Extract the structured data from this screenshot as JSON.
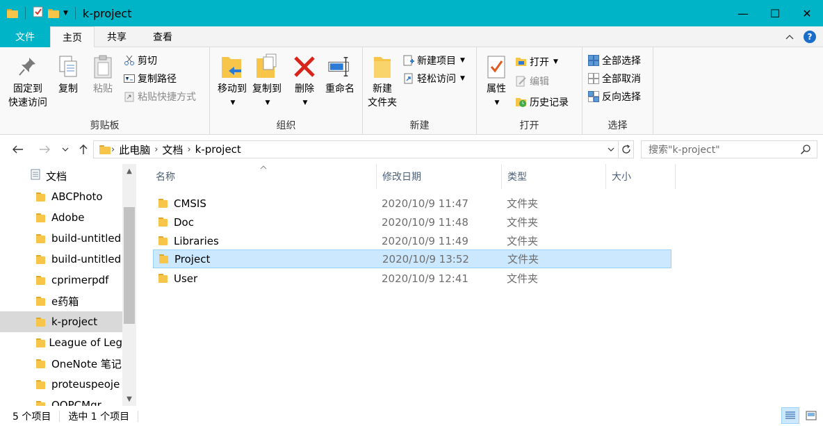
{
  "window": {
    "title": "k-project",
    "minimize": "—",
    "maximize": "☐",
    "close": "✕"
  },
  "tabs": {
    "file": "文件",
    "home": "主页",
    "share": "共享",
    "view": "查看",
    "help": "?"
  },
  "ribbon": {
    "clipboard": {
      "label": "剪贴板",
      "pin_line1": "固定到",
      "pin_line2": "快速访问",
      "copy": "复制",
      "paste": "粘贴",
      "cut": "剪切",
      "copy_path": "复制路径",
      "paste_shortcut": "粘贴快捷方式"
    },
    "organize": {
      "label": "组织",
      "move_to": "移动到",
      "copy_to": "复制到",
      "delete": "删除",
      "rename": "重命名"
    },
    "new": {
      "label": "新建",
      "new_folder_line1": "新建",
      "new_folder_line2": "文件夹",
      "new_item": "新建项目",
      "easy_access": "轻松访问"
    },
    "open": {
      "label": "打开",
      "properties": "属性",
      "open": "打开",
      "edit": "编辑",
      "history": "历史记录"
    },
    "select": {
      "label": "选择",
      "select_all": "全部选择",
      "select_none": "全部取消",
      "invert": "反向选择"
    }
  },
  "address": {
    "crumbs": [
      "此电脑",
      "文档",
      "k-project"
    ],
    "search_placeholder": "搜索\"k-project\""
  },
  "nav_tree": {
    "root": "文档",
    "items": [
      "ABCPhoto",
      "Adobe",
      "build-untitled",
      "build-untitled",
      "cprimerpdf",
      "e药箱",
      "k-project",
      "League of Leg",
      "OneNote 笔记",
      "proteuspeoje",
      "QQPCMgr"
    ],
    "selected_index": 6
  },
  "columns": {
    "name": "名称",
    "date": "修改日期",
    "type": "类型",
    "size": "大小"
  },
  "files": [
    {
      "name": "CMSIS",
      "date": "2020/10/9 11:47",
      "type": "文件夹"
    },
    {
      "name": "Doc",
      "date": "2020/10/9 11:48",
      "type": "文件夹"
    },
    {
      "name": "Libraries",
      "date": "2020/10/9 11:49",
      "type": "文件夹"
    },
    {
      "name": "Project",
      "date": "2020/10/9 13:52",
      "type": "文件夹"
    },
    {
      "name": "User",
      "date": "2020/10/9 12:41",
      "type": "文件夹"
    }
  ],
  "selected_file_index": 3,
  "status": {
    "item_count": "5 个项目",
    "selected": "选中 1 个项目"
  },
  "colors": {
    "accent": "#00b4c8",
    "selection": "#cce8ff",
    "folder": "#f6c549"
  }
}
